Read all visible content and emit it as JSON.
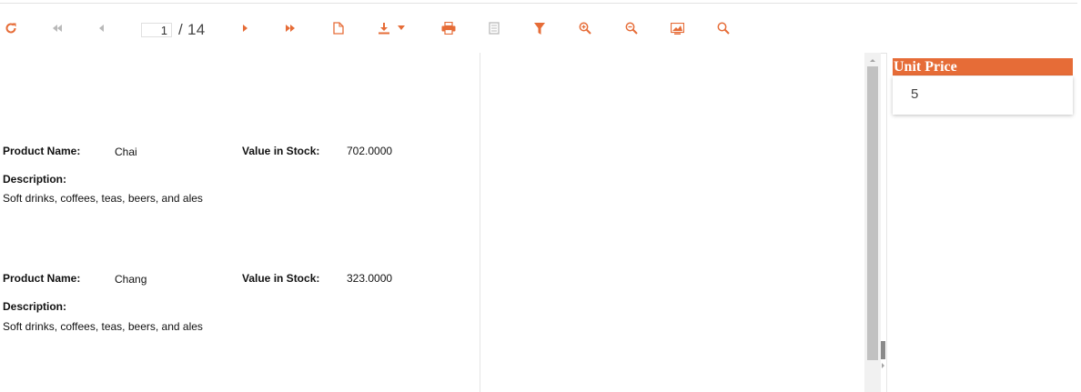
{
  "toolbar": {
    "page_current": "1",
    "page_total": "/ 14",
    "buttons": [
      {
        "name": "refresh",
        "icon": "refresh-icon",
        "enabled": true
      },
      {
        "name": "first-page",
        "icon": "first-page-icon",
        "enabled": false
      },
      {
        "name": "prev-page",
        "icon": "prev-page-icon",
        "enabled": false
      },
      {
        "name": "next-page",
        "icon": "next-page-icon",
        "enabled": true
      },
      {
        "name": "last-page",
        "icon": "last-page-icon",
        "enabled": true
      },
      {
        "name": "page-setup",
        "icon": "document-icon",
        "enabled": true
      },
      {
        "name": "export",
        "icon": "download-icon",
        "enabled": true
      },
      {
        "name": "print",
        "icon": "print-icon",
        "enabled": true
      },
      {
        "name": "document-map",
        "icon": "document-map-icon",
        "enabled": false
      },
      {
        "name": "parameters",
        "icon": "filter-icon",
        "enabled": true
      },
      {
        "name": "zoom-in",
        "icon": "zoom-in-icon",
        "enabled": true
      },
      {
        "name": "zoom-out",
        "icon": "zoom-out-icon",
        "enabled": true
      },
      {
        "name": "view-mode",
        "icon": "view-mode-icon",
        "enabled": true
      },
      {
        "name": "search",
        "icon": "search-icon",
        "enabled": true
      }
    ]
  },
  "report": {
    "records": [
      {
        "product_label": "Product Name:",
        "product_value": "Chai",
        "stock_label": "Value in Stock:",
        "stock_value": "702.0000",
        "desc_label": "Description:",
        "desc_value": "Soft drinks, coffees, teas, beers, and ales"
      },
      {
        "product_label": "Product Name:",
        "product_value": "Chang",
        "stock_label": "Value in Stock:",
        "stock_value": "323.0000",
        "desc_label": "Description:",
        "desc_value": "Soft drinks, coffees, teas, beers, and ales"
      }
    ]
  },
  "parameters": {
    "title": "Unit Price",
    "value": "5"
  },
  "colors": {
    "accent": "#e66c37",
    "disabled": "#b9b9b9"
  }
}
